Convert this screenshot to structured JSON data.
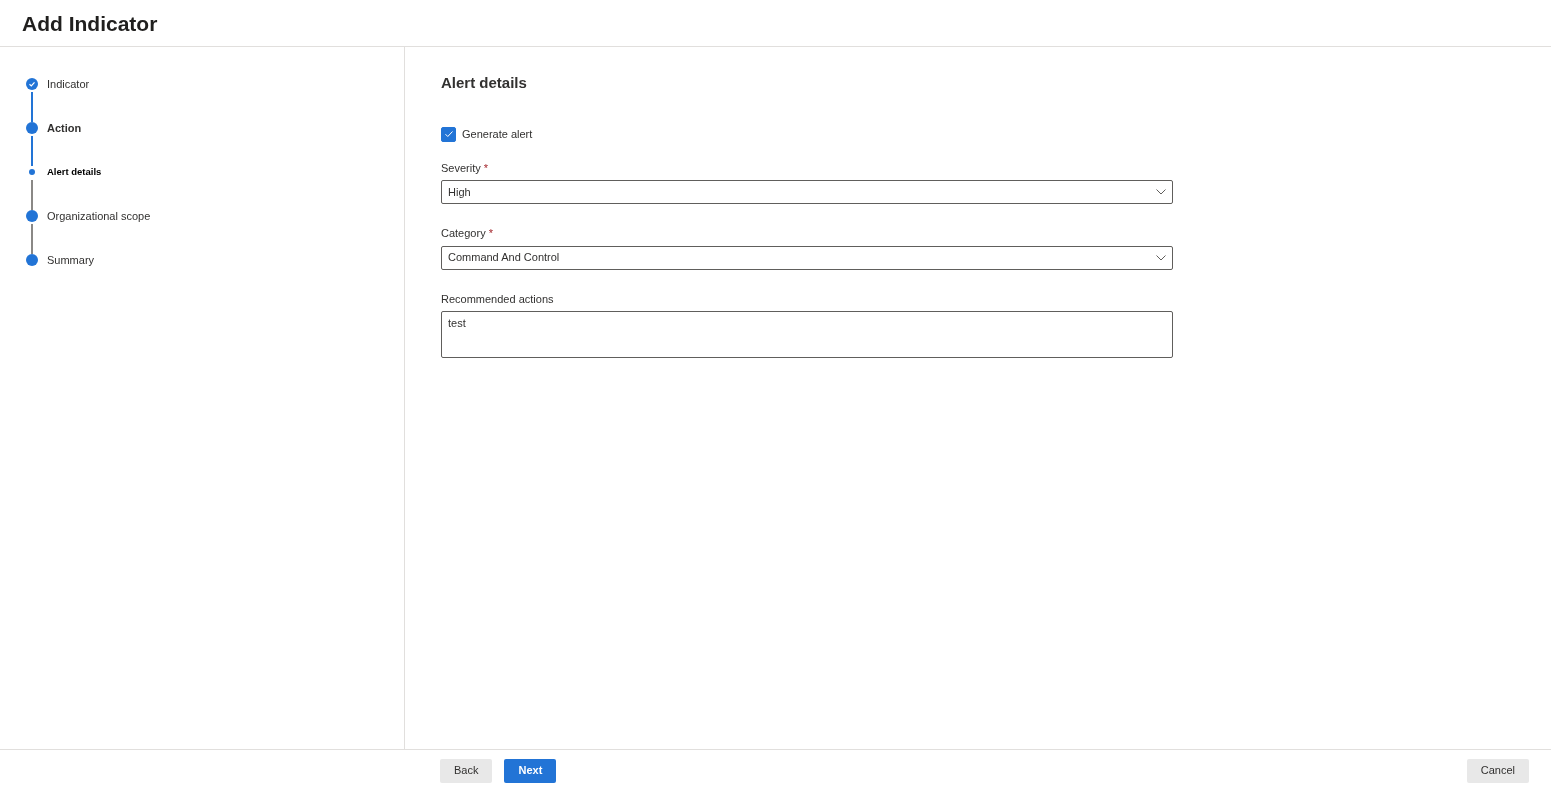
{
  "title": "Add Indicator",
  "steps": [
    {
      "label": "Indicator",
      "kind": "step",
      "completed": true,
      "current": false,
      "selected": false
    },
    {
      "label": "Action",
      "kind": "step",
      "completed": false,
      "current": true,
      "selected": false
    },
    {
      "label": "Alert details",
      "kind": "substep",
      "completed": false,
      "current": true,
      "selected": true
    },
    {
      "label": "Organizational scope",
      "kind": "step",
      "completed": false,
      "current": false,
      "selected": false
    },
    {
      "label": "Summary",
      "kind": "step",
      "completed": false,
      "current": false,
      "selected": false
    }
  ],
  "section_title": "Alert details",
  "generate_alert": {
    "label": "Generate alert",
    "checked": true
  },
  "fields": [
    {
      "label": "Severity",
      "required": true,
      "kind": "dropdown",
      "value": "High"
    },
    {
      "label": "Category",
      "required": true,
      "kind": "dropdown",
      "value": "Command And Control"
    },
    {
      "label": "Recommended actions",
      "required": false,
      "kind": "textarea",
      "value": "test"
    }
  ],
  "required_mark": "*",
  "footer": {
    "buttons": [
      {
        "label": "Back",
        "kind": "secondary"
      },
      {
        "label": "Next",
        "kind": "primary"
      }
    ],
    "cancel": "Cancel"
  }
}
